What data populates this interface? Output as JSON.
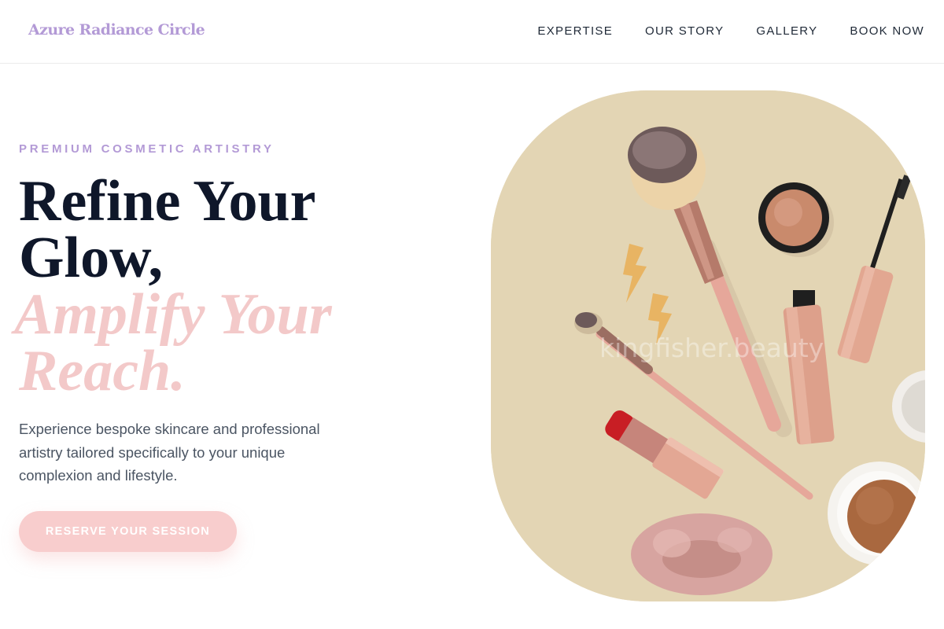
{
  "brand": {
    "name": "Azure Radiance Circle"
  },
  "nav": {
    "items": [
      "EXPERTISE",
      "OUR STORY",
      "GALLERY",
      "BOOK NOW"
    ]
  },
  "hero": {
    "eyebrow": "PREMIUM COSMETIC ARTISTRY",
    "headline": {
      "line1": "Refine Your",
      "line2": "Glow,",
      "accent_line1": "Amplify Your",
      "accent_line2": "Reach."
    },
    "description": "Experience bespoke skincare and professional artistry tailored specifically to your unique complexion and lifestyle.",
    "cta_label": "RESERVE YOUR SESSION",
    "image": {
      "watermark": "kingfisher.beauty",
      "alt": "Flat lay of makeup brushes, lipstick, mascara, powder compacts and a velvet scrunchie on a beige background"
    }
  },
  "colors": {
    "brand_lavender": "#b39ad6",
    "accent_pink": "#f3c9c9",
    "button_pink": "#f8cdcd",
    "heading_dark": "#0f172a",
    "image_bg": "#e3d5b4"
  }
}
